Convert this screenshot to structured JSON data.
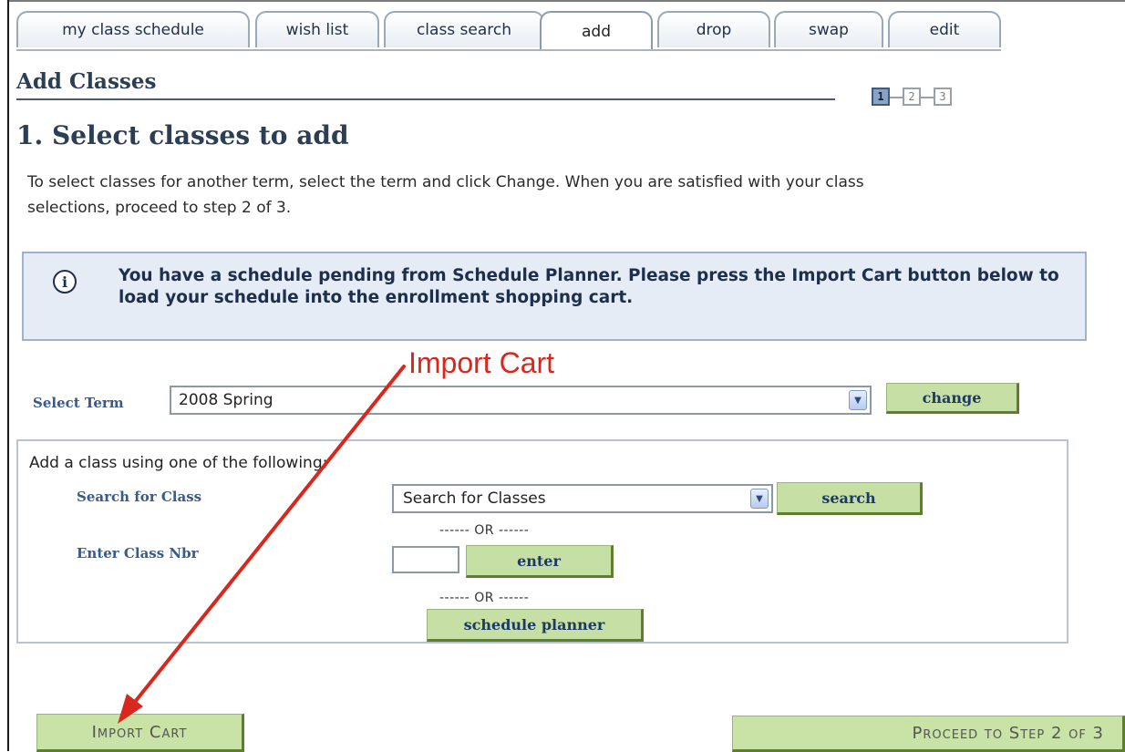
{
  "tabs": [
    {
      "label": "my class schedule",
      "active": false
    },
    {
      "label": "wish list",
      "active": false
    },
    {
      "label": "class search",
      "active": false
    },
    {
      "label": "add",
      "active": true
    },
    {
      "label": "drop",
      "active": false
    },
    {
      "label": "swap",
      "active": false
    },
    {
      "label": "edit",
      "active": false
    }
  ],
  "page": {
    "title": "Add Classes",
    "step_title": "1. Select classes to add",
    "intro": "To select classes for another term, select the term and click Change. When you are satisfied with your class selections, proceed to step 2 of 3."
  },
  "steps": {
    "items": [
      "1",
      "2",
      "3"
    ],
    "current": 1
  },
  "info": {
    "icon": "info-icon",
    "text": "You have a schedule pending from Schedule Planner.  Please press the Import Cart button below to load your schedule into the enrollment shopping cart."
  },
  "annotation": {
    "label": "Import Cart",
    "color": "#d8281e"
  },
  "term": {
    "label": "Select Term",
    "value": "2008 Spring",
    "change_label": "change"
  },
  "add_class": {
    "title": "Add a class using one of the following:",
    "search_label": "Search for Class",
    "search_value": "Search for Classes",
    "search_button": "search",
    "or_text": "------ OR ------",
    "class_nbr_label": "Enter Class Nbr",
    "class_nbr_value": "",
    "enter_button": "enter",
    "planner_button": "schedule planner"
  },
  "footer": {
    "import_label": "Import Cart",
    "proceed_label": "Proceed to Step 2 of 3"
  },
  "colors": {
    "button_green": "#c6dfa4",
    "info_bg": "#e6ecf5",
    "heading": "#2b3e54",
    "label_blue": "#3a5a8a"
  }
}
